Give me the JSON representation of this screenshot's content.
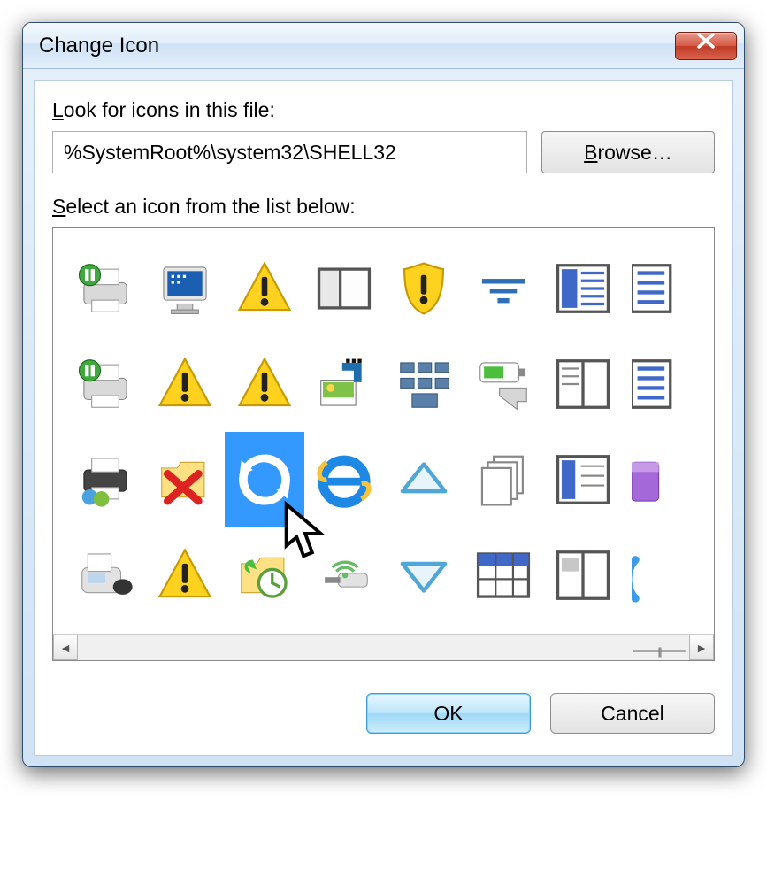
{
  "title": "Change Icon",
  "look_label_pre": "L",
  "look_label_rest": "ook for icons in this file:",
  "path_value": "%SystemRoot%\\system32\\SHELL32",
  "browse_underline": "B",
  "browse_rest": "rowse…",
  "select_label_pre": "S",
  "select_label_rest": "elect an icon from the list below:",
  "ok_label": "OK",
  "cancel_label": "Cancel",
  "icons": {
    "r1": [
      "printer-pause-icon",
      "monitor-bluescreen-icon",
      "warning-icon",
      "docked-window-icon",
      "shield-warning-icon",
      "filter-icon",
      "details-view-icon",
      "list-partial-icon"
    ],
    "r2": [
      "printer-pause-icon",
      "warning-icon",
      "warning-icon",
      "media-files-icon",
      "tiles-icon",
      "battery-eject-icon",
      "reading-pane-icon",
      "list-partial-icon"
    ],
    "r3": [
      "shared-printer-icon",
      "delete-folder-icon",
      "refresh-icon",
      "internet-explorer-icon",
      "triangle-up-icon",
      "stack-icon",
      "column-pane-icon",
      "purple-drive-partial-icon"
    ],
    "r4": [
      "fax-icon",
      "warning-icon",
      "folder-history-icon",
      "wireless-dongle-icon",
      "triangle-down-icon",
      "table-view-icon",
      "split-view-icon",
      "paperclip-partial-icon"
    ]
  },
  "selected": "refresh-icon"
}
